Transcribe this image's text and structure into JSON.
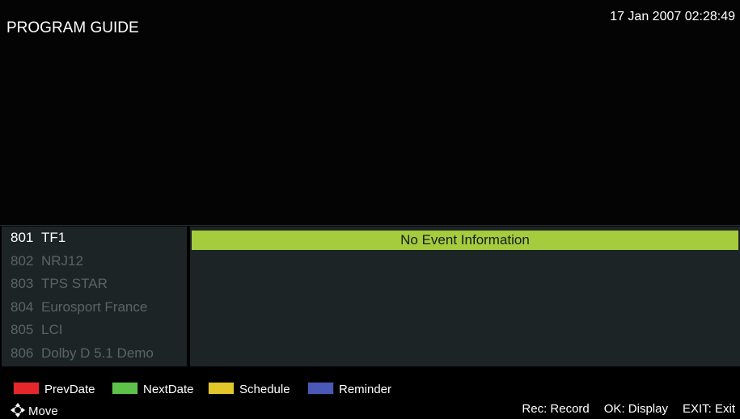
{
  "header": {
    "title": "PROGRAM GUIDE",
    "datetime": "17 Jan 2007 02:28:49"
  },
  "channels": [
    {
      "number": "801",
      "name": "TF1",
      "selected": true
    },
    {
      "number": "802",
      "name": "NRJ12",
      "selected": false
    },
    {
      "number": "803",
      "name": "TPS STAR",
      "selected": false
    },
    {
      "number": "804",
      "name": "Eurosport France",
      "selected": false
    },
    {
      "number": "805",
      "name": "LCI",
      "selected": false
    },
    {
      "number": "806",
      "name": "Dolby D 5.1 Demo",
      "selected": false
    }
  ],
  "epg": {
    "event_text": "No Event Information"
  },
  "footer": {
    "keys": [
      {
        "label": "PrevDate",
        "color": "#e5262b"
      },
      {
        "label": "NextDate",
        "color": "#5dc24a"
      },
      {
        "label": "Schedule",
        "color": "#e2c62a"
      },
      {
        "label": "Reminder",
        "color": "#4a58b8"
      }
    ],
    "move_label": "Move",
    "hints": {
      "record": "Rec: Record",
      "display": "OK: Display",
      "exit": "EXIT: Exit"
    }
  },
  "colors": {
    "event_bar": "#a5cc3d",
    "panel_bg": "#1c2426"
  }
}
